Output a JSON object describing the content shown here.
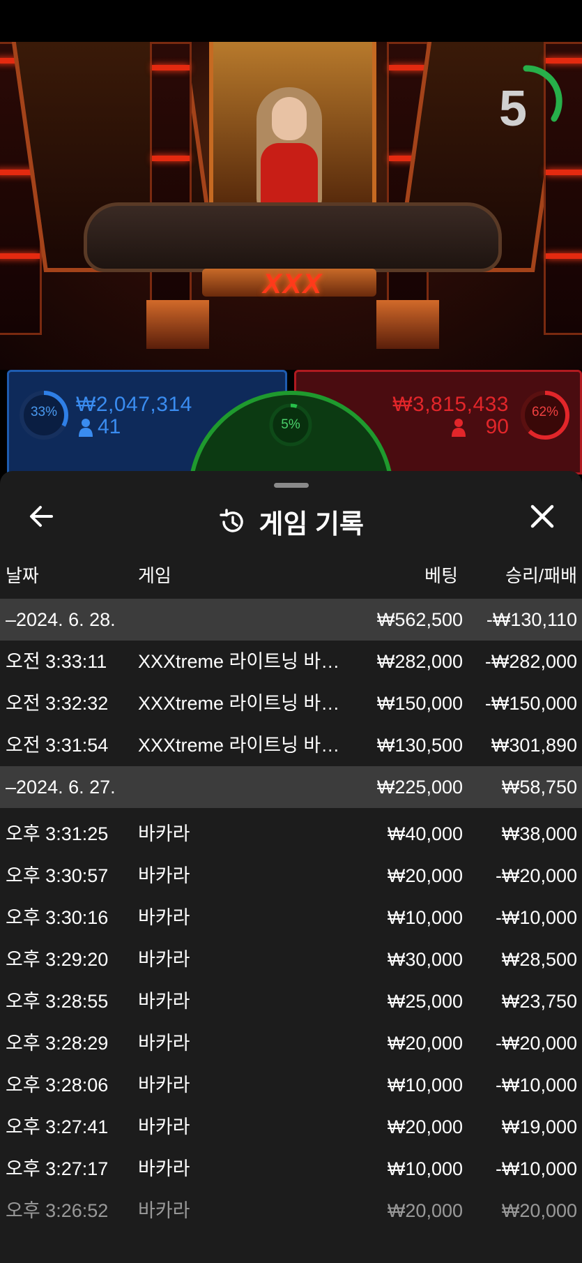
{
  "timer": {
    "seconds": "5"
  },
  "table_logo": "XXX",
  "bets": {
    "player": {
      "percent": "33%",
      "amount": "₩2,047,314",
      "players": "41",
      "color": "#2f7fe6"
    },
    "tie": {
      "percent": "5%",
      "color": "#27c04a"
    },
    "banker": {
      "percent": "62%",
      "amount": "₩3,815,433",
      "players": "90",
      "color": "#e2262a"
    }
  },
  "history": {
    "title": "게임 기록",
    "icons": {
      "back": "arrow-left-icon",
      "history": "history-clock-icon",
      "close": "close-icon"
    },
    "columns": {
      "date": "날짜",
      "game": "게임",
      "bet": "베팅",
      "result": "승리/패배"
    },
    "groups": [
      {
        "date": "–2024. 6. 28.",
        "bet": "₩562,500",
        "result": "-₩130,110",
        "rows": [
          {
            "time": "오전 3:33:11",
            "game": "XXXtreme 라이트닝 바카라",
            "bet": "₩282,000",
            "result": "-₩282,000"
          },
          {
            "time": "오전 3:32:32",
            "game": "XXXtreme 라이트닝 바카라",
            "bet": "₩150,000",
            "result": "-₩150,000"
          },
          {
            "time": "오전 3:31:54",
            "game": "XXXtreme 라이트닝 바카라",
            "bet": "₩130,500",
            "result": "₩301,890"
          }
        ]
      },
      {
        "date": "–2024. 6. 27.",
        "bet": "₩225,000",
        "result": "₩58,750",
        "rows": [
          {
            "time": "오후 3:31:25",
            "game": "바카라",
            "bet": "₩40,000",
            "result": "₩38,000"
          },
          {
            "time": "오후 3:30:57",
            "game": "바카라",
            "bet": "₩20,000",
            "result": "-₩20,000"
          },
          {
            "time": "오후 3:30:16",
            "game": "바카라",
            "bet": "₩10,000",
            "result": "-₩10,000"
          },
          {
            "time": "오후 3:29:20",
            "game": "바카라",
            "bet": "₩30,000",
            "result": "₩28,500"
          },
          {
            "time": "오후 3:28:55",
            "game": "바카라",
            "bet": "₩25,000",
            "result": "₩23,750"
          },
          {
            "time": "오후 3:28:29",
            "game": "바카라",
            "bet": "₩20,000",
            "result": "-₩20,000"
          },
          {
            "time": "오후 3:28:06",
            "game": "바카라",
            "bet": "₩10,000",
            "result": "-₩10,000"
          },
          {
            "time": "오후 3:27:41",
            "game": "바카라",
            "bet": "₩20,000",
            "result": "₩19,000"
          },
          {
            "time": "오후 3:27:17",
            "game": "바카라",
            "bet": "₩10,000",
            "result": "-₩10,000"
          },
          {
            "time": "오후 3:26:52",
            "game": "바카라",
            "bet": "₩20,000",
            "result": "₩20,000"
          }
        ]
      }
    ]
  }
}
